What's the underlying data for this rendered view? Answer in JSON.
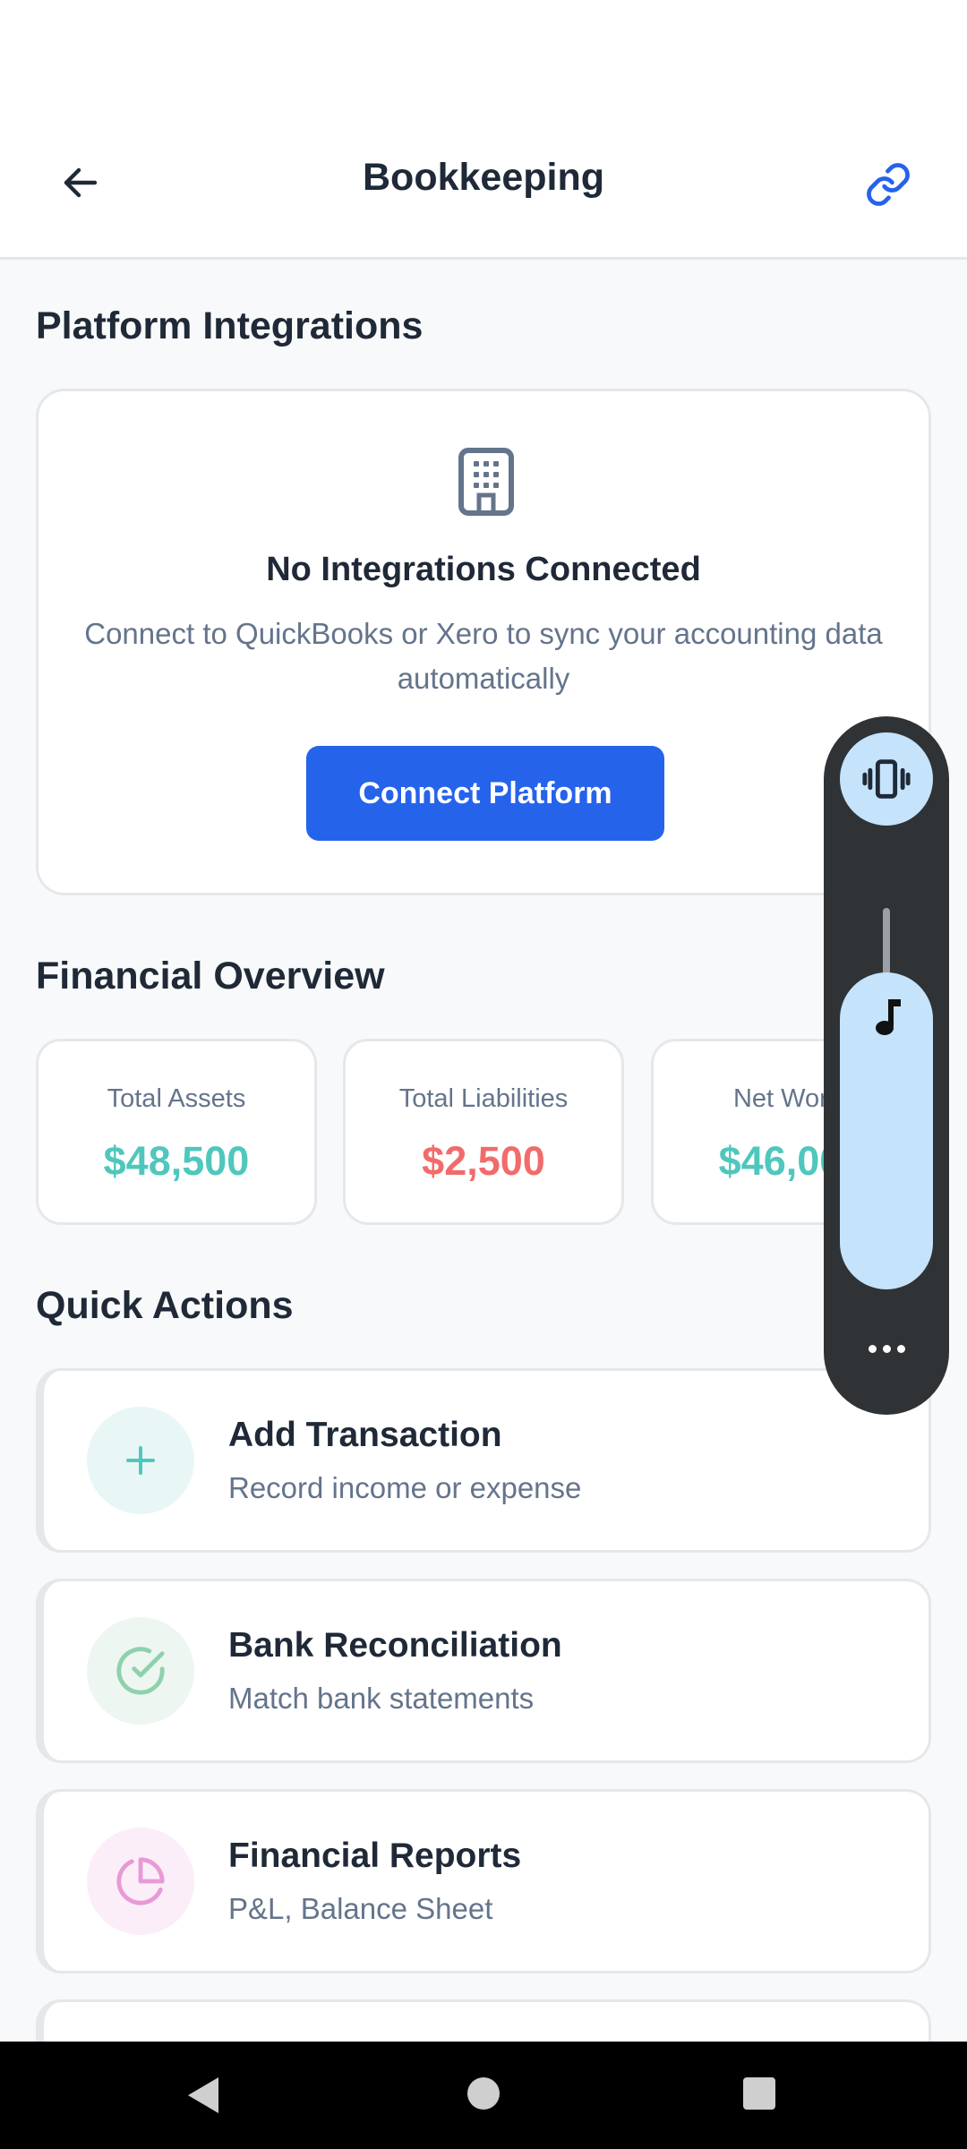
{
  "header": {
    "title": "Bookkeeping",
    "back_icon": "arrow-left-icon",
    "link_icon": "link-icon"
  },
  "integrations": {
    "section_title": "Platform Integrations",
    "icon": "building-icon",
    "empty_title": "No Integrations Connected",
    "empty_description": "Connect to QuickBooks or Xero to sync your accounting data automatically",
    "connect_button": "Connect Platform"
  },
  "overview": {
    "section_title": "Financial Overview",
    "stats": [
      {
        "label": "Total Assets",
        "value": "$48,500",
        "color": "#4fc7bd"
      },
      {
        "label": "Total Liabilities",
        "value": "$2,500",
        "color": "#f26b6b"
      },
      {
        "label": "Net Worth",
        "value": "$46,000",
        "color": "#4fc7bd"
      }
    ]
  },
  "quick_actions": {
    "section_title": "Quick Actions",
    "items": [
      {
        "title": "Add Transaction",
        "subtitle": "Record income or expense",
        "icon": "plus-icon",
        "icon_color": "#4fc7bd",
        "icon_bg": "#e8f7f5"
      },
      {
        "title": "Bank Reconciliation",
        "subtitle": "Match bank statements",
        "icon": "check-circle-icon",
        "icon_color": "#8fd1ac",
        "icon_bg": "#eef6f1"
      },
      {
        "title": "Financial Reports",
        "subtitle": "P&L, Balance Sheet",
        "icon": "pie-chart-icon",
        "icon_color": "#e79ad6",
        "icon_bg": "#fbeef8"
      }
    ]
  },
  "volume_panel": {
    "mode_icon": "vibrate-icon",
    "stream_icon": "music-note-icon",
    "more_icon": "more-horizontal-icon",
    "level": 0.82
  },
  "colors": {
    "primary": "#2563eb",
    "text": "#1f2937",
    "muted": "#64748b",
    "border": "#e5e7eb"
  }
}
